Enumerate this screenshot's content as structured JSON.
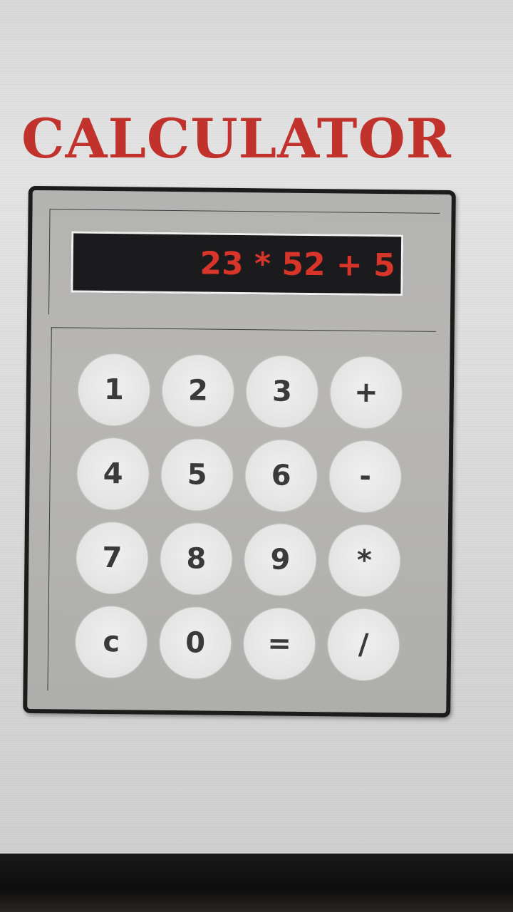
{
  "title": "CALCULATOR",
  "display": {
    "expression": "23 * 52 + 5"
  },
  "keypad": {
    "keys": [
      {
        "label": "1",
        "name": "key-1-button"
      },
      {
        "label": "2",
        "name": "key-2-button"
      },
      {
        "label": "3",
        "name": "key-3-button"
      },
      {
        "label": "+",
        "name": "key-add-button"
      },
      {
        "label": "4",
        "name": "key-4-button"
      },
      {
        "label": "5",
        "name": "key-5-button"
      },
      {
        "label": "6",
        "name": "key-6-button"
      },
      {
        "label": "-",
        "name": "key-subtract-button"
      },
      {
        "label": "7",
        "name": "key-7-button"
      },
      {
        "label": "8",
        "name": "key-8-button"
      },
      {
        "label": "9",
        "name": "key-9-button"
      },
      {
        "label": "*",
        "name": "key-multiply-button"
      },
      {
        "label": "c",
        "name": "key-clear-button"
      },
      {
        "label": "0",
        "name": "key-0-button"
      },
      {
        "label": "=",
        "name": "key-equals-button"
      },
      {
        "label": "/",
        "name": "key-divide-button"
      }
    ]
  },
  "colors": {
    "title": "#c0322b",
    "display_background": "#1b1b1d",
    "display_text": "#d8352a",
    "key_background": "#e6e6e6",
    "key_text": "#3a3a3a",
    "body_border": "#1c1c1c"
  }
}
